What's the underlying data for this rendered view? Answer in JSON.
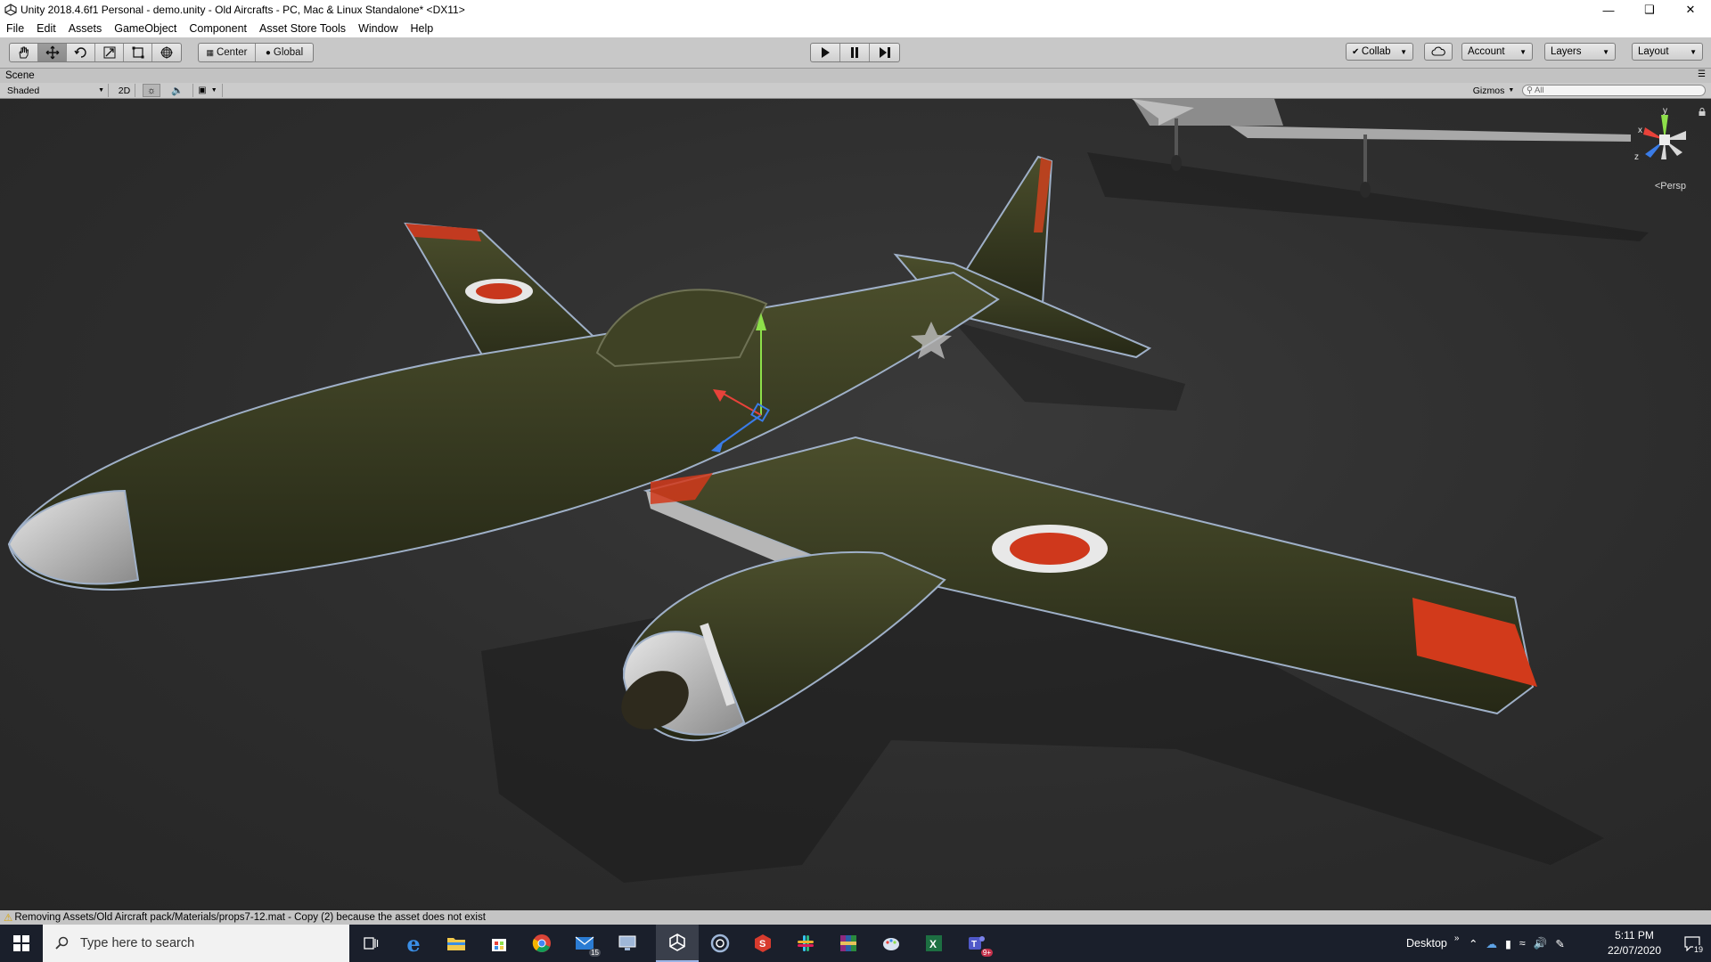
{
  "window": {
    "title": "Unity 2018.4.6f1 Personal - demo.unity - Old Aircrafts - PC, Mac & Linux Standalone* <DX11>",
    "controls": [
      "minimize-icon",
      "restore-icon",
      "close-icon"
    ]
  },
  "menu": [
    "File",
    "Edit",
    "Assets",
    "GameObject",
    "Component",
    "Asset Store Tools",
    "Window",
    "Help"
  ],
  "toolbar": {
    "tools": [
      "hand-tool-icon",
      "move-tool-icon",
      "rotate-tool-icon",
      "scale-tool-icon",
      "rect-tool-icon",
      "transform-tool-icon"
    ],
    "active_tool": "move-tool-icon",
    "pivot_label": "Center",
    "space_label": "Global",
    "play_controls": [
      "play-icon",
      "pause-icon",
      "step-icon"
    ],
    "collab_label": "Collab",
    "account_label": "Account",
    "layers_label": "Layers",
    "layout_label": "Layout"
  },
  "scene": {
    "tab_label": "Scene",
    "shading_mode": "Shaded",
    "mode_2d_label": "2D",
    "gizmos_label": "Gizmos",
    "search_placeholder": "All",
    "projection_label": "Persp",
    "axis_labels": {
      "x": "x",
      "y": "y",
      "z": "z"
    }
  },
  "status": {
    "message": "Removing Assets/Old Aircraft pack/Materials/props7-12.mat - Copy (2) because the asset does not exist"
  },
  "taskbar": {
    "search_placeholder": "Type here to search",
    "apps": [
      {
        "icon": "task-view-icon"
      },
      {
        "icon": "edge-icon"
      },
      {
        "icon": "file-explorer-icon"
      },
      {
        "icon": "store-icon"
      },
      {
        "icon": "chrome-icon"
      },
      {
        "icon": "mail-icon",
        "badge": "15"
      },
      {
        "icon": "network-app-icon"
      },
      {
        "icon": "unity-icon",
        "active": true
      },
      {
        "icon": "cortana-icon"
      },
      {
        "icon": "red-app-icon"
      },
      {
        "icon": "slack-icon"
      },
      {
        "icon": "winrar-icon"
      },
      {
        "icon": "paint-icon"
      },
      {
        "icon": "excel-icon"
      },
      {
        "icon": "teams-icon",
        "badge": "9+"
      }
    ],
    "desktop_label": "Desktop",
    "time": "5:11 PM",
    "date": "22/07/2020",
    "notification_count": "19"
  },
  "colors": {
    "editor_bg": "#c8c8c8",
    "viewport_bg": "#2e2e2e",
    "aircraft_body": "#3a3d22",
    "roundel_red": "#d63a1e",
    "taskbar_bg": "#1a1f2b"
  }
}
